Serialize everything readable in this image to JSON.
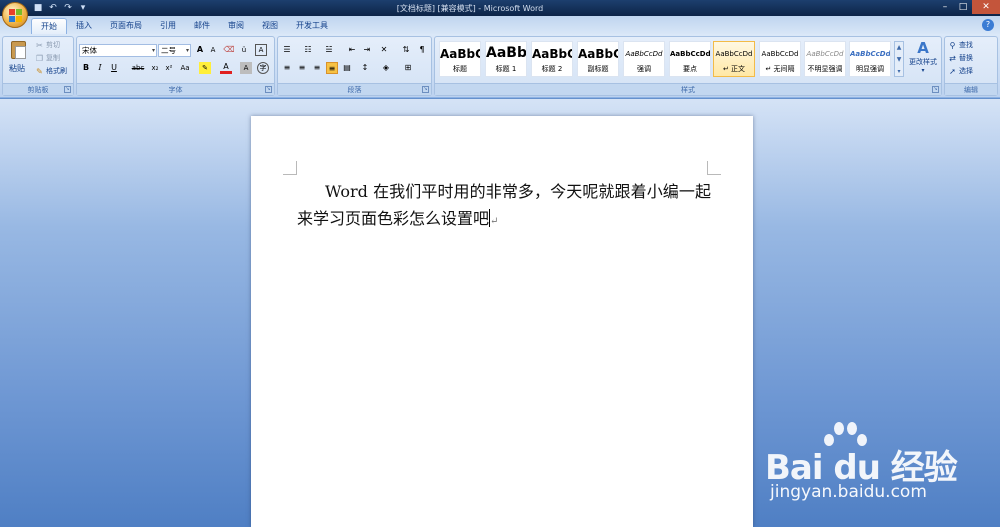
{
  "window": {
    "title": "[文档标题] [兼容模式] - Microsoft Word",
    "controls": {
      "minimize": "–",
      "maximize": "□",
      "close": "✕"
    }
  },
  "quick_access": [
    "save-icon",
    "undo-icon",
    "redo-icon",
    "customize-icon"
  ],
  "tabs": [
    {
      "label": "开始",
      "active": true
    },
    {
      "label": "插入"
    },
    {
      "label": "页面布局"
    },
    {
      "label": "引用"
    },
    {
      "label": "邮件"
    },
    {
      "label": "审阅"
    },
    {
      "label": "视图"
    },
    {
      "label": "开发工具"
    }
  ],
  "ribbon": {
    "clipboard": {
      "label": "剪贴板",
      "paste": "粘贴",
      "cut": "剪切",
      "copy": "复制",
      "format_painter": "格式刷"
    },
    "font": {
      "label": "字体",
      "font_name": "宋体",
      "font_size": "二号",
      "grow": "A",
      "shrink": "A",
      "bold": "B",
      "italic": "I",
      "underline": "U",
      "strike": "abc",
      "subscript": "x₂",
      "superscript": "x²",
      "change_case": "Aa",
      "font_color": "A",
      "char_border": "A",
      "char_shading": "A",
      "enclose": "字"
    },
    "paragraph": {
      "label": "段落"
    },
    "styles": {
      "label": "样式",
      "items": [
        {
          "sample": "AaBbC",
          "name": "标题"
        },
        {
          "sample": "AaBb",
          "name": "标题 1"
        },
        {
          "sample": "AaBbC",
          "name": "标题 2"
        },
        {
          "sample": "AaBbC",
          "name": "副标题"
        },
        {
          "sample": "AaBbCcDd",
          "name": "强调"
        },
        {
          "sample": "AaBbCcDd",
          "name": "要点"
        },
        {
          "sample": "AaBbCcDd",
          "name": "↵ 正文",
          "selected": true
        },
        {
          "sample": "AaBbCcDd",
          "name": "↵ 无间隔"
        },
        {
          "sample": "AaBbCcDd",
          "name": "不明显强调"
        },
        {
          "sample": "AaBbCcDd",
          "name": "明显强调"
        }
      ],
      "change_styles": "更改样式"
    },
    "editing": {
      "label": "编辑",
      "find": "查找",
      "replace": "替换",
      "select": "选择"
    }
  },
  "document": {
    "text": "Word 在我们平时用的非常多，今天呢就跟着小编一起来学习页面色彩怎么设置吧"
  },
  "watermark": {
    "logo": "Bai du 经验",
    "url": "jingyan.baidu.com"
  },
  "colors": {
    "accent": "#15428b",
    "ribbon_bg": "#d3e2f5",
    "doc_bg": "#6e97d3",
    "selected_style": "#ffe8a6"
  }
}
